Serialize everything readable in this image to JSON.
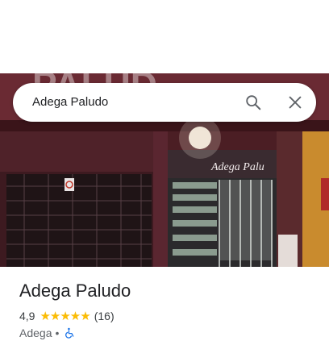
{
  "search": {
    "query": "Adega Paludo"
  },
  "place": {
    "title": "Adega Paludo",
    "rating": "4,9",
    "stars": "★★★★★",
    "review_count": "(16)",
    "category": "Adega",
    "separator": "•"
  },
  "photo": {
    "sign_text": "Adega Palu"
  },
  "icons": {
    "search": "search-icon",
    "close": "close-icon",
    "accessibility": "wheelchair-accessible-icon"
  },
  "colors": {
    "star": "#fbbc04",
    "accessibility": "#1a73e8",
    "storefront_wall": "#4a1f24"
  }
}
